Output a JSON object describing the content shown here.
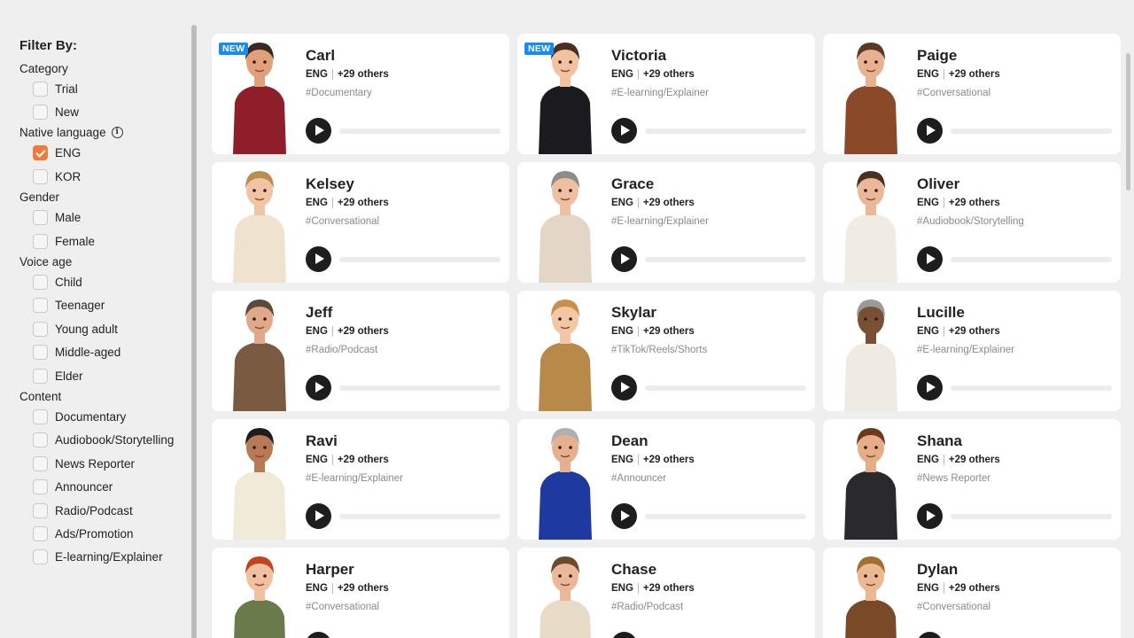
{
  "filters": {
    "title": "Filter By:",
    "groups": [
      {
        "title": "Category",
        "info": false,
        "options": [
          {
            "label": "Trial",
            "checked": false
          },
          {
            "label": "New",
            "checked": false
          }
        ]
      },
      {
        "title": "Native language",
        "info": true,
        "options": [
          {
            "label": "ENG",
            "checked": true
          },
          {
            "label": "KOR",
            "checked": false
          }
        ]
      },
      {
        "title": "Gender",
        "info": false,
        "options": [
          {
            "label": "Male",
            "checked": false
          },
          {
            "label": "Female",
            "checked": false
          }
        ]
      },
      {
        "title": "Voice age",
        "info": false,
        "options": [
          {
            "label": "Child",
            "checked": false
          },
          {
            "label": "Teenager",
            "checked": false
          },
          {
            "label": "Young adult",
            "checked": false
          },
          {
            "label": "Middle-aged",
            "checked": false
          },
          {
            "label": "Elder",
            "checked": false
          }
        ]
      },
      {
        "title": "Content",
        "info": false,
        "options": [
          {
            "label": "Documentary",
            "checked": false
          },
          {
            "label": "Audiobook/Storytelling",
            "checked": false
          },
          {
            "label": "News Reporter",
            "checked": false
          },
          {
            "label": "Announcer",
            "checked": false
          },
          {
            "label": "Radio/Podcast",
            "checked": false
          },
          {
            "label": "Ads/Promotion",
            "checked": false
          },
          {
            "label": "E-learning/Explainer",
            "checked": false
          }
        ]
      }
    ]
  },
  "voices": [
    {
      "name": "Carl",
      "badge": "NEW",
      "lang": "ENG",
      "others": "+29 others",
      "tag": "#Documentary",
      "top": "#8e1f2a",
      "bottom": "#2c2f3a",
      "skin": "#e0a07a",
      "hair": "#3a2a1f"
    },
    {
      "name": "Victoria",
      "badge": "NEW",
      "lang": "ENG",
      "others": "+29 others",
      "tag": "#E-learning/Explainer",
      "top": "#1a1a1f",
      "bottom": "#1a1a1f",
      "skin": "#f2c2a0",
      "hair": "#4a2f22"
    },
    {
      "name": "Paige",
      "badge": "",
      "lang": "ENG",
      "others": "+29 others",
      "tag": "#Conversational",
      "top": "#8a4a2a",
      "bottom": "#2a2a2a",
      "skin": "#e8b190",
      "hair": "#5a3a24"
    },
    {
      "name": "Kelsey",
      "badge": "",
      "lang": "ENG",
      "others": "+29 others",
      "tag": "#Conversational",
      "top": "#efe3cf",
      "bottom": "#d8c9b2",
      "skin": "#f1c4a4",
      "hair": "#b8904e"
    },
    {
      "name": "Grace",
      "badge": "",
      "lang": "ENG",
      "others": "+29 others",
      "tag": "#E-learning/Explainer",
      "top": "#e4d6c6",
      "bottom": "#9a8670",
      "skin": "#efc0a0",
      "hair": "#8c8c8c"
    },
    {
      "name": "Oliver",
      "badge": "",
      "lang": "ENG",
      "others": "+29 others",
      "tag": "#Audiobook/Storytelling",
      "top": "#f0ece4",
      "bottom": "#7a6a48",
      "skin": "#eab896",
      "hair": "#4a3020"
    },
    {
      "name": "Jeff",
      "badge": "",
      "lang": "ENG",
      "others": "+29 others",
      "tag": "#Radio/Podcast",
      "top": "#7a5a40",
      "bottom": "#3a4e6e",
      "skin": "#e0a98a",
      "hair": "#5a4a3a"
    },
    {
      "name": "Skylar",
      "badge": "",
      "lang": "ENG",
      "others": "+29 others",
      "tag": "#TikTok/Reels/Shorts",
      "top": "#b88a4a",
      "bottom": "#a37a3a",
      "skin": "#f3c7a6",
      "hair": "#c8904a"
    },
    {
      "name": "Lucille",
      "badge": "",
      "lang": "ENG",
      "others": "+29 others",
      "tag": "#E-learning/Explainer",
      "top": "#efeae2",
      "bottom": "#efeae2",
      "skin": "#7a5034",
      "hair": "#9a9a9a"
    },
    {
      "name": "Ravi",
      "badge": "",
      "lang": "ENG",
      "others": "+29 others",
      "tag": "#E-learning/Explainer",
      "top": "#f2ead8",
      "bottom": "#e8dcc4",
      "skin": "#b87a54",
      "hair": "#1e1e1e"
    },
    {
      "name": "Dean",
      "badge": "",
      "lang": "ENG",
      "others": "+29 others",
      "tag": "#Announcer",
      "top": "#1e3aa0",
      "bottom": "#1e3aa0",
      "skin": "#e6b08e",
      "hair": "#b0b0b0"
    },
    {
      "name": "Shana",
      "badge": "",
      "lang": "ENG",
      "others": "+29 others",
      "tag": "#News Reporter",
      "top": "#2a2a2e",
      "bottom": "#2a2a2e",
      "skin": "#e6ad88",
      "hair": "#6a3a20"
    },
    {
      "name": "Harper",
      "badge": "",
      "lang": "ENG",
      "others": "+29 others",
      "tag": "#Conversational",
      "top": "#6a7a4a",
      "bottom": "#5a6a3e",
      "skin": "#f0c0a0",
      "hair": "#c0441e"
    },
    {
      "name": "Chase",
      "badge": "",
      "lang": "ENG",
      "others": "+29 others",
      "tag": "#Radio/Podcast",
      "top": "#e8dcc8",
      "bottom": "#d8ccb8",
      "skin": "#eab896",
      "hair": "#6a4a2a"
    },
    {
      "name": "Dylan",
      "badge": "",
      "lang": "ENG",
      "others": "+29 others",
      "tag": "#Conversational",
      "top": "#7a4a28",
      "bottom": "#5a3a20",
      "skin": "#ecb894",
      "hair": "#a0702e"
    }
  ]
}
